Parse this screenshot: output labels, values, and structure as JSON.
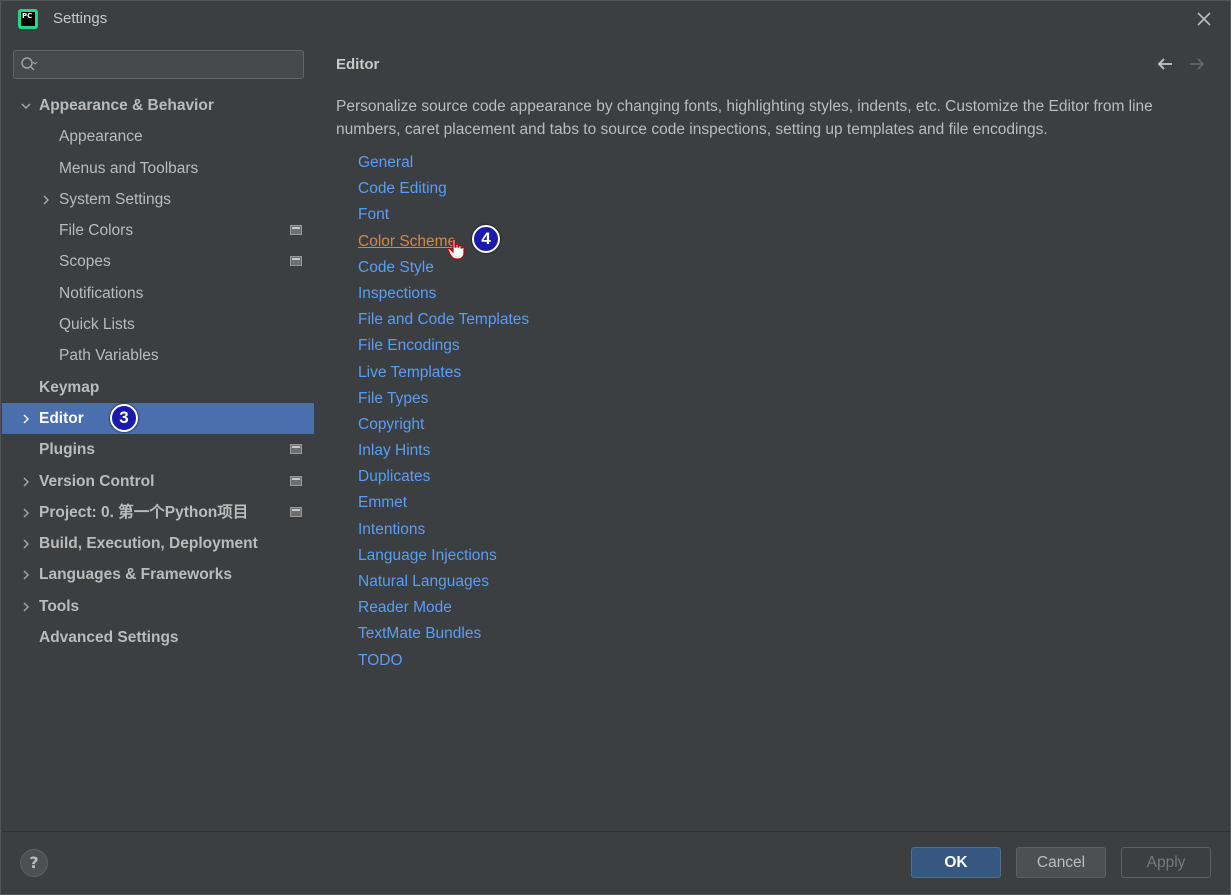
{
  "window": {
    "title": "Settings",
    "app_icon_text": [
      "PC"
    ]
  },
  "search": {
    "placeholder": "",
    "value": ""
  },
  "sidebar": {
    "items": [
      {
        "label": "Appearance & Behavior",
        "level": 0,
        "bold": true,
        "expandable": true,
        "expanded": true
      },
      {
        "label": "Appearance",
        "level": 1
      },
      {
        "label": "Menus and Toolbars",
        "level": 1
      },
      {
        "label": "System Settings",
        "level": 1,
        "expandable": true
      },
      {
        "label": "File Colors",
        "level": 1,
        "project_icon": true
      },
      {
        "label": "Scopes",
        "level": 1,
        "project_icon": true
      },
      {
        "label": "Notifications",
        "level": 1
      },
      {
        "label": "Quick Lists",
        "level": 1
      },
      {
        "label": "Path Variables",
        "level": 1
      },
      {
        "label": "Keymap",
        "level": 0,
        "bold": true
      },
      {
        "label": "Editor",
        "level": 0,
        "bold": true,
        "expandable": true,
        "selected": true,
        "badge": "3"
      },
      {
        "label": "Plugins",
        "level": 0,
        "bold": true,
        "project_icon": true
      },
      {
        "label": "Version Control",
        "level": 0,
        "bold": true,
        "expandable": true,
        "project_icon": true
      },
      {
        "label": "Project: 0. 第一个Python项目",
        "level": 0,
        "bold": true,
        "expandable": true,
        "project_icon": true
      },
      {
        "label": "Build, Execution, Deployment",
        "level": 0,
        "bold": true,
        "expandable": true
      },
      {
        "label": "Languages & Frameworks",
        "level": 0,
        "bold": true,
        "expandable": true
      },
      {
        "label": "Tools",
        "level": 0,
        "bold": true,
        "expandable": true
      },
      {
        "label": "Advanced Settings",
        "level": 0,
        "bold": true
      }
    ]
  },
  "main": {
    "breadcrumb": "Editor",
    "back_icon": "arrow-left-icon",
    "forward_icon": "arrow-right-icon",
    "description": "Personalize source code appearance by changing fonts, highlighting styles, indents, etc. Customize the Editor from line numbers, caret placement and tabs to source code inspections, setting up templates and file encodings.",
    "links": [
      {
        "label": "General"
      },
      {
        "label": "Code Editing"
      },
      {
        "label": "Font"
      },
      {
        "label": "Color Scheme",
        "hover": true,
        "badge": "4"
      },
      {
        "label": "Code Style"
      },
      {
        "label": "Inspections"
      },
      {
        "label": "File and Code Templates"
      },
      {
        "label": "File Encodings"
      },
      {
        "label": "Live Templates"
      },
      {
        "label": "File Types"
      },
      {
        "label": "Copyright"
      },
      {
        "label": "Inlay Hints"
      },
      {
        "label": "Duplicates"
      },
      {
        "label": "Emmet"
      },
      {
        "label": "Intentions"
      },
      {
        "label": "Language Injections"
      },
      {
        "label": "Natural Languages"
      },
      {
        "label": "Reader Mode"
      },
      {
        "label": "TextMate Bundles"
      },
      {
        "label": "TODO"
      }
    ]
  },
  "footer": {
    "help_label": "?",
    "ok_label": "OK",
    "cancel_label": "Cancel",
    "apply_label": "Apply"
  },
  "colors": {
    "background": "#3c3f41",
    "selection": "#4b6eaf",
    "link": "#589df6",
    "link_hover": "#d08a48",
    "badge": "#1a1aa8"
  }
}
